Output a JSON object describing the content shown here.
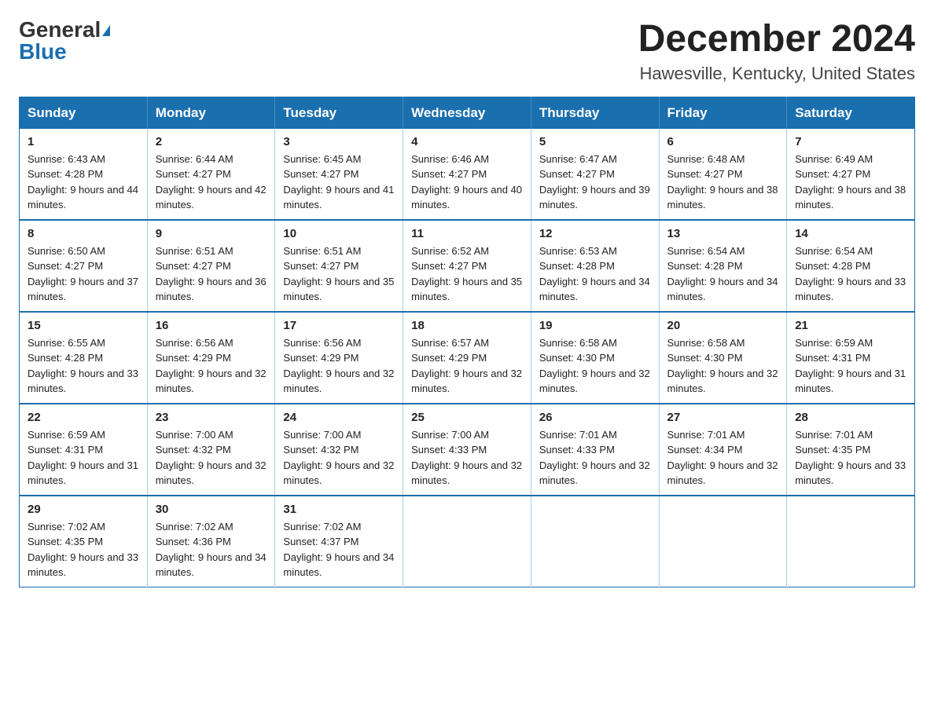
{
  "header": {
    "logo_general": "General",
    "logo_blue": "Blue",
    "main_title": "December 2024",
    "subtitle": "Hawesville, Kentucky, United States"
  },
  "days_of_week": [
    "Sunday",
    "Monday",
    "Tuesday",
    "Wednesday",
    "Thursday",
    "Friday",
    "Saturday"
  ],
  "weeks": [
    [
      {
        "day": "1",
        "sunrise": "6:43 AM",
        "sunset": "4:28 PM",
        "daylight": "9 hours and 44 minutes."
      },
      {
        "day": "2",
        "sunrise": "6:44 AM",
        "sunset": "4:27 PM",
        "daylight": "9 hours and 42 minutes."
      },
      {
        "day": "3",
        "sunrise": "6:45 AM",
        "sunset": "4:27 PM",
        "daylight": "9 hours and 41 minutes."
      },
      {
        "day": "4",
        "sunrise": "6:46 AM",
        "sunset": "4:27 PM",
        "daylight": "9 hours and 40 minutes."
      },
      {
        "day": "5",
        "sunrise": "6:47 AM",
        "sunset": "4:27 PM",
        "daylight": "9 hours and 39 minutes."
      },
      {
        "day": "6",
        "sunrise": "6:48 AM",
        "sunset": "4:27 PM",
        "daylight": "9 hours and 38 minutes."
      },
      {
        "day": "7",
        "sunrise": "6:49 AM",
        "sunset": "4:27 PM",
        "daylight": "9 hours and 38 minutes."
      }
    ],
    [
      {
        "day": "8",
        "sunrise": "6:50 AM",
        "sunset": "4:27 PM",
        "daylight": "9 hours and 37 minutes."
      },
      {
        "day": "9",
        "sunrise": "6:51 AM",
        "sunset": "4:27 PM",
        "daylight": "9 hours and 36 minutes."
      },
      {
        "day": "10",
        "sunrise": "6:51 AM",
        "sunset": "4:27 PM",
        "daylight": "9 hours and 35 minutes."
      },
      {
        "day": "11",
        "sunrise": "6:52 AM",
        "sunset": "4:27 PM",
        "daylight": "9 hours and 35 minutes."
      },
      {
        "day": "12",
        "sunrise": "6:53 AM",
        "sunset": "4:28 PM",
        "daylight": "9 hours and 34 minutes."
      },
      {
        "day": "13",
        "sunrise": "6:54 AM",
        "sunset": "4:28 PM",
        "daylight": "9 hours and 34 minutes."
      },
      {
        "day": "14",
        "sunrise": "6:54 AM",
        "sunset": "4:28 PM",
        "daylight": "9 hours and 33 minutes."
      }
    ],
    [
      {
        "day": "15",
        "sunrise": "6:55 AM",
        "sunset": "4:28 PM",
        "daylight": "9 hours and 33 minutes."
      },
      {
        "day": "16",
        "sunrise": "6:56 AM",
        "sunset": "4:29 PM",
        "daylight": "9 hours and 32 minutes."
      },
      {
        "day": "17",
        "sunrise": "6:56 AM",
        "sunset": "4:29 PM",
        "daylight": "9 hours and 32 minutes."
      },
      {
        "day": "18",
        "sunrise": "6:57 AM",
        "sunset": "4:29 PM",
        "daylight": "9 hours and 32 minutes."
      },
      {
        "day": "19",
        "sunrise": "6:58 AM",
        "sunset": "4:30 PM",
        "daylight": "9 hours and 32 minutes."
      },
      {
        "day": "20",
        "sunrise": "6:58 AM",
        "sunset": "4:30 PM",
        "daylight": "9 hours and 32 minutes."
      },
      {
        "day": "21",
        "sunrise": "6:59 AM",
        "sunset": "4:31 PM",
        "daylight": "9 hours and 31 minutes."
      }
    ],
    [
      {
        "day": "22",
        "sunrise": "6:59 AM",
        "sunset": "4:31 PM",
        "daylight": "9 hours and 31 minutes."
      },
      {
        "day": "23",
        "sunrise": "7:00 AM",
        "sunset": "4:32 PM",
        "daylight": "9 hours and 32 minutes."
      },
      {
        "day": "24",
        "sunrise": "7:00 AM",
        "sunset": "4:32 PM",
        "daylight": "9 hours and 32 minutes."
      },
      {
        "day": "25",
        "sunrise": "7:00 AM",
        "sunset": "4:33 PM",
        "daylight": "9 hours and 32 minutes."
      },
      {
        "day": "26",
        "sunrise": "7:01 AM",
        "sunset": "4:33 PM",
        "daylight": "9 hours and 32 minutes."
      },
      {
        "day": "27",
        "sunrise": "7:01 AM",
        "sunset": "4:34 PM",
        "daylight": "9 hours and 32 minutes."
      },
      {
        "day": "28",
        "sunrise": "7:01 AM",
        "sunset": "4:35 PM",
        "daylight": "9 hours and 33 minutes."
      }
    ],
    [
      {
        "day": "29",
        "sunrise": "7:02 AM",
        "sunset": "4:35 PM",
        "daylight": "9 hours and 33 minutes."
      },
      {
        "day": "30",
        "sunrise": "7:02 AM",
        "sunset": "4:36 PM",
        "daylight": "9 hours and 34 minutes."
      },
      {
        "day": "31",
        "sunrise": "7:02 AM",
        "sunset": "4:37 PM",
        "daylight": "9 hours and 34 minutes."
      },
      null,
      null,
      null,
      null
    ]
  ]
}
